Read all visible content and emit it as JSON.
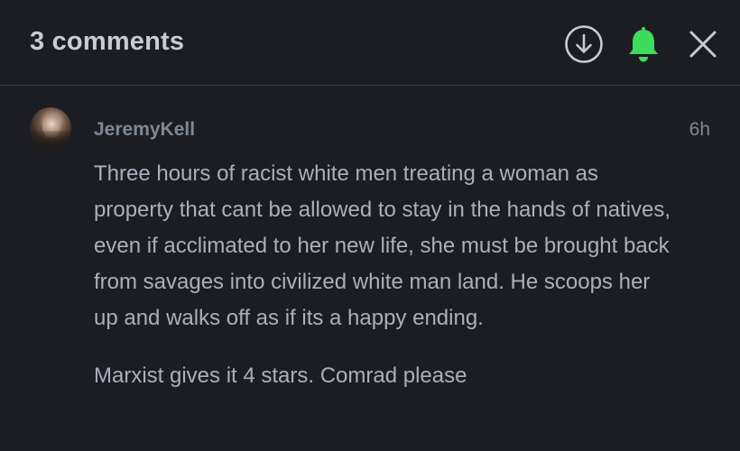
{
  "header": {
    "title": "3 comments",
    "download_icon": "download-icon",
    "bell_icon": "bell-icon",
    "close_icon": "close-icon"
  },
  "colors": {
    "background": "#1b1d22",
    "bell_green": "#3ddc5a",
    "title_text": "#c7ccd4",
    "muted_text": "#7f8793",
    "body_text": "#aab0bb"
  },
  "comment": {
    "username": "JeremyKell",
    "time": "6h",
    "paragraph_1": "Three hours of racist white men treating a woman as property that cant be allowed to stay in the hands of natives, even if acclimated to her new life, she must be brought back from savages into civilized white man land. He scoops her up and walks off as if its a happy ending.",
    "paragraph_2": "Marxist gives it 4 stars. Comrad please"
  }
}
